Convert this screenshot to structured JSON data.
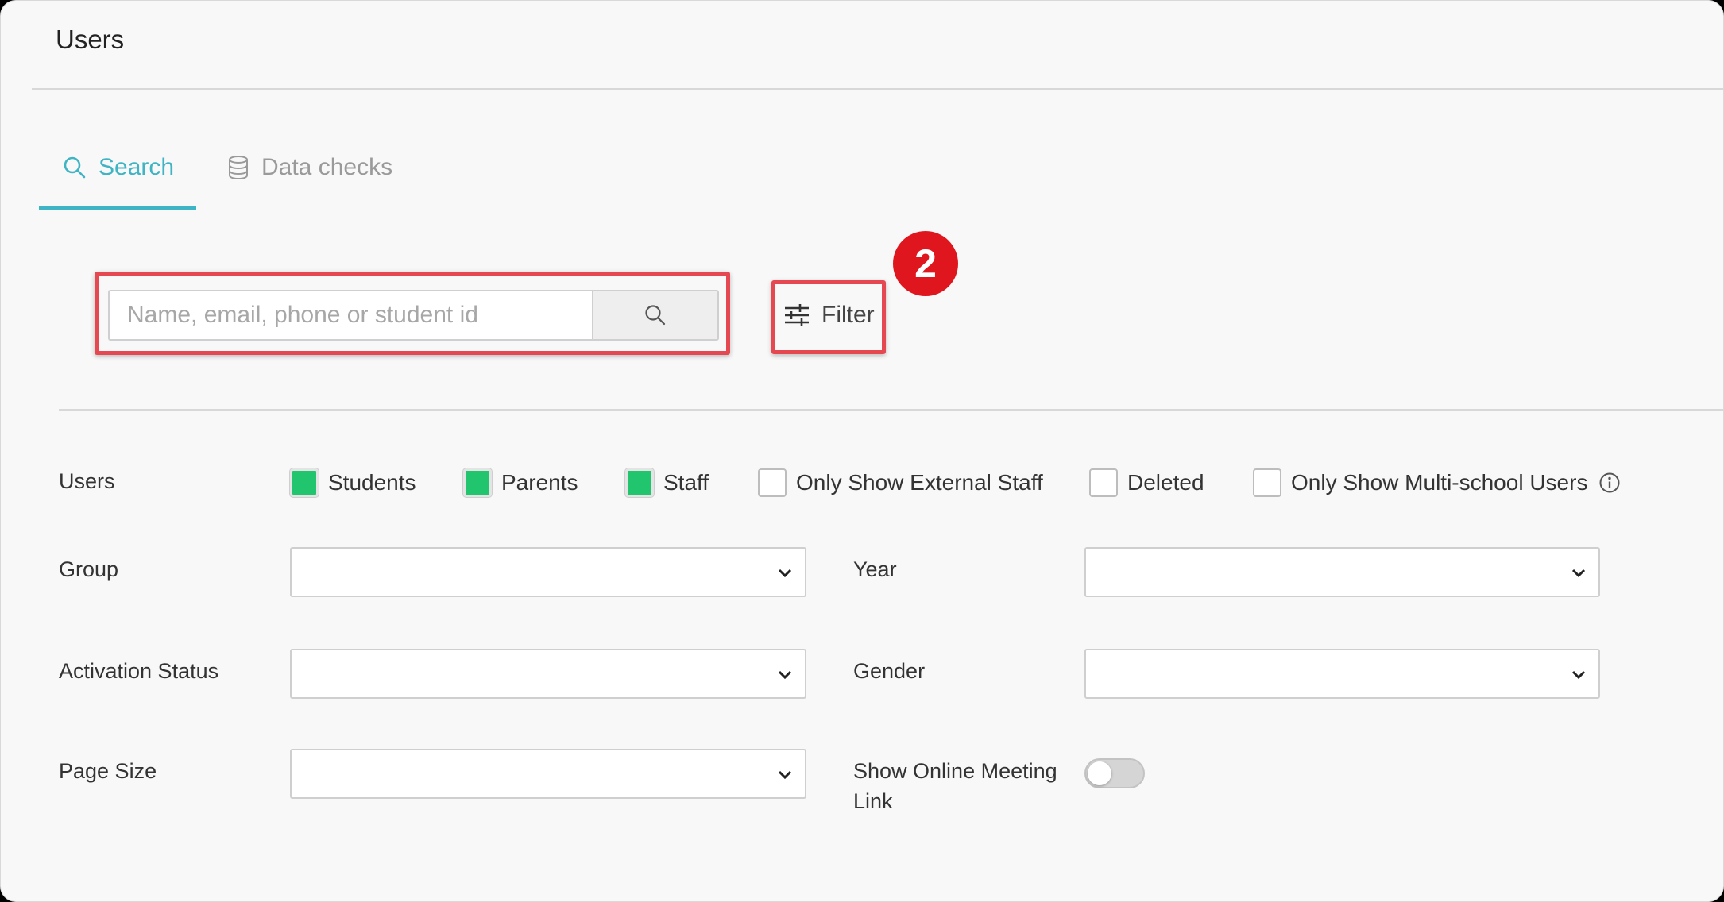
{
  "page": {
    "title": "Users"
  },
  "tabs": [
    {
      "label": "Search",
      "icon": "search-icon",
      "active": true
    },
    {
      "label": "Data checks",
      "icon": "database-icon",
      "active": false
    }
  ],
  "search": {
    "placeholder": "Name, email, phone or student id",
    "value": ""
  },
  "filter": {
    "label": "Filter",
    "icon": "sliders-icon"
  },
  "annotation": {
    "badge": "2"
  },
  "filters": {
    "users_label": "Users",
    "checkboxes": [
      {
        "label": "Students",
        "checked": true
      },
      {
        "label": "Parents",
        "checked": true
      },
      {
        "label": "Staff",
        "checked": true
      },
      {
        "label": "Only Show External Staff",
        "checked": false
      },
      {
        "label": "Deleted",
        "checked": false
      },
      {
        "label": "Only Show Multi-school Users",
        "checked": false
      }
    ],
    "group_label": "Group",
    "year_label": "Year",
    "activation_label": "Activation Status",
    "gender_label": "Gender",
    "page_size_label": "Page Size",
    "online_meeting_label": "Show Online Meeting Link",
    "online_meeting_on": false
  },
  "colors": {
    "accent": "#3fb4c4",
    "checked": "#21c56d",
    "highlight": "#e54850",
    "badge": "#e0161f"
  }
}
